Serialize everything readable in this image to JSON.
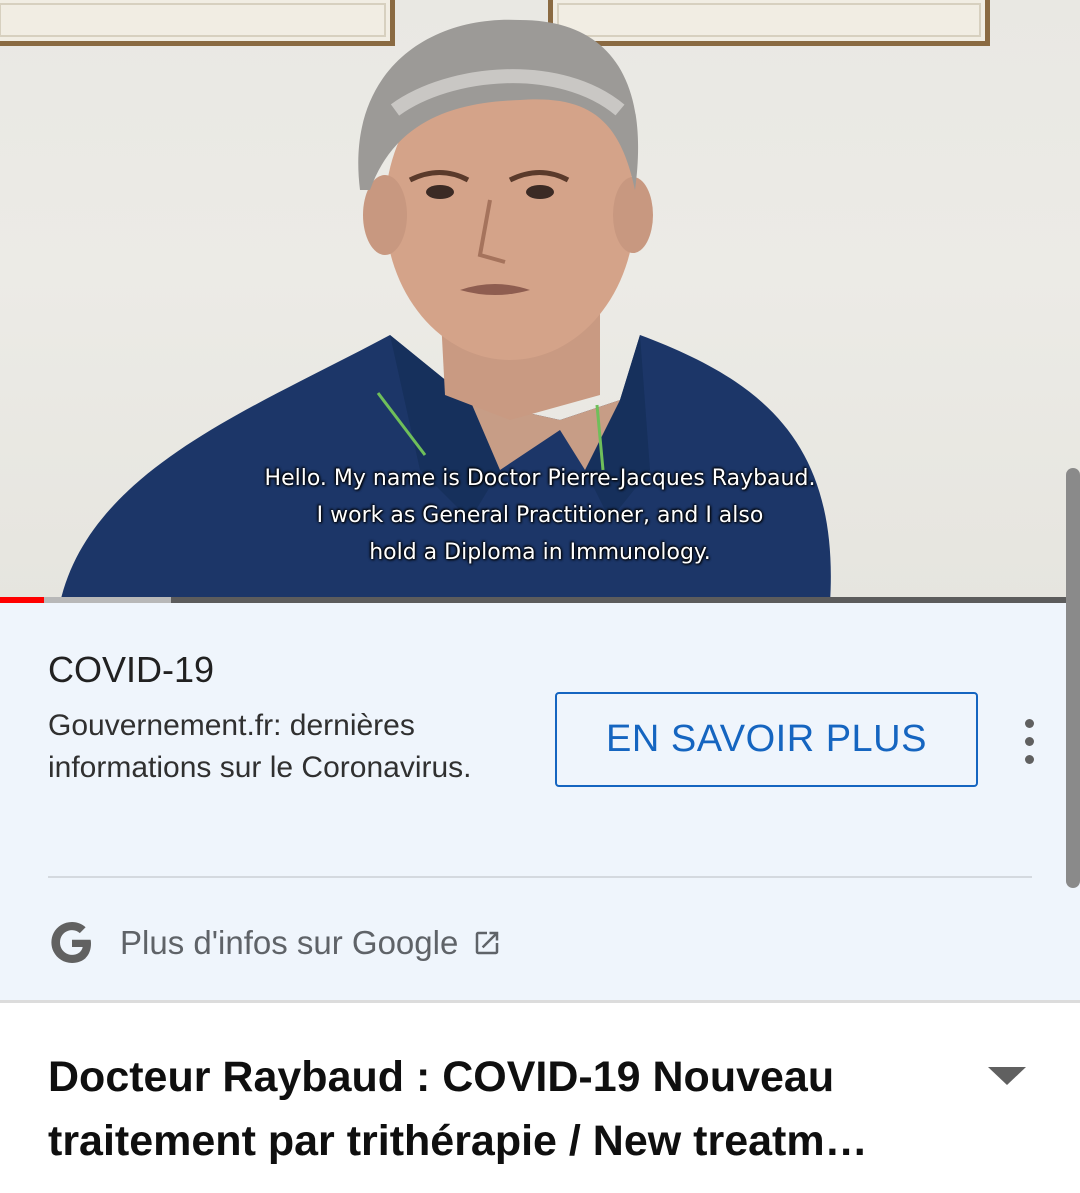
{
  "player": {
    "subtitle_lines": [
      "Hello. My name is Doctor Pierre-Jacques Raybaud.",
      "I work as General Practitioner, and I also",
      "hold a Diploma in Immunology."
    ],
    "progress_played_fraction": 0.041,
    "progress_buffered_fraction": 0.158
  },
  "ad": {
    "title": "COVID-19",
    "description": "Gouvernement.fr: dernières informations sur le Coronavirus.",
    "cta_label": "EN SAVOIR PLUS",
    "google_link": "Plus d'infos sur Google"
  },
  "video": {
    "title_line_1": "Docteur Raybaud : COVID-19 Nouveau",
    "title_line_2": "traitement par trithérapie / New treatm…"
  },
  "colors": {
    "progress_played": "#ff0000",
    "cta_blue": "#1565c0",
    "ad_background": "#eff5fc"
  }
}
